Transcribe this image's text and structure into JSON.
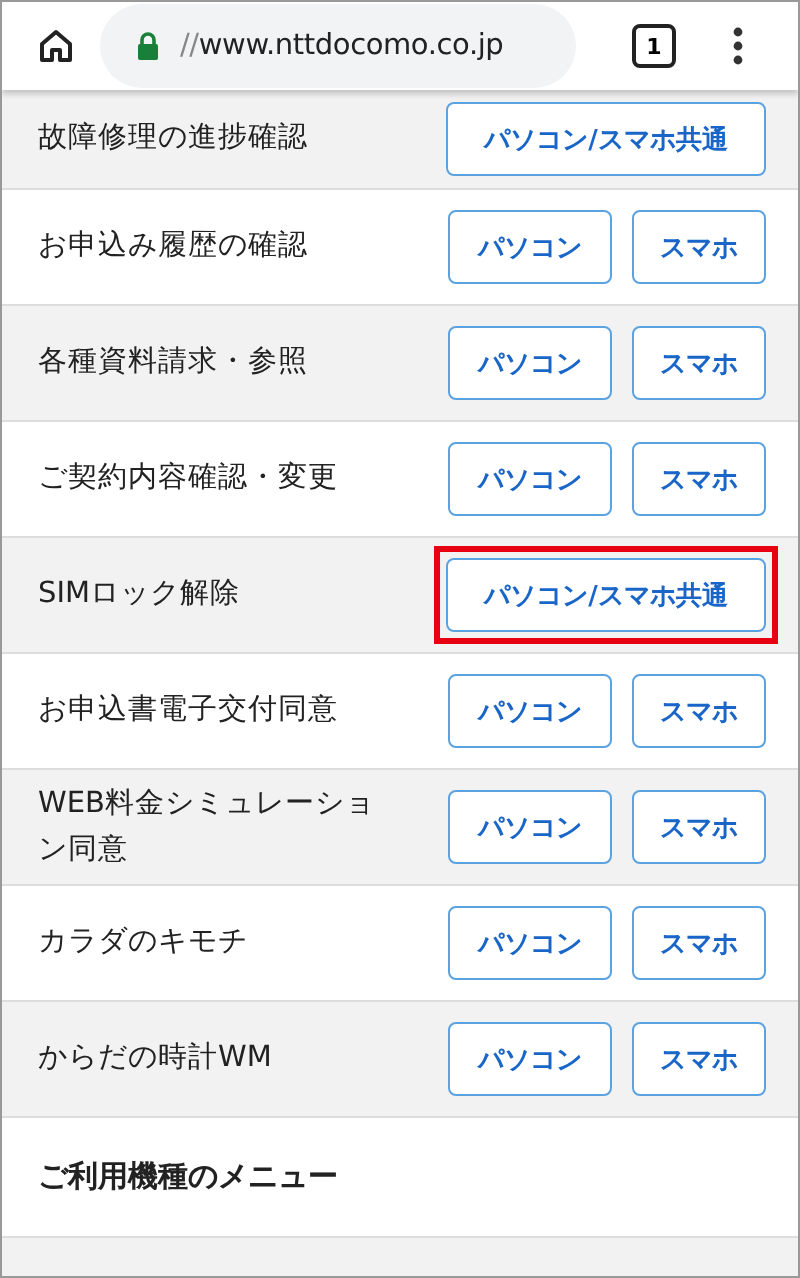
{
  "browser": {
    "url_prefix": "//",
    "url_host": "www.nttdocomo.co.jp",
    "tab_count": "1"
  },
  "rows": [
    {
      "label": "故障修理の進捗確認",
      "highlighted": false,
      "buttons": [
        {
          "label": "パソコン/スマホ共通",
          "kind": "wide"
        }
      ]
    },
    {
      "label": "お申込み履歴の確認",
      "highlighted": false,
      "buttons": [
        {
          "label": "パソコン",
          "kind": "normal"
        },
        {
          "label": "スマホ",
          "kind": "small"
        }
      ]
    },
    {
      "label": "各種資料請求・参照",
      "highlighted": false,
      "buttons": [
        {
          "label": "パソコン",
          "kind": "normal"
        },
        {
          "label": "スマホ",
          "kind": "small"
        }
      ]
    },
    {
      "label": "ご契約内容確認・変更",
      "highlighted": false,
      "buttons": [
        {
          "label": "パソコン",
          "kind": "normal"
        },
        {
          "label": "スマホ",
          "kind": "small"
        }
      ]
    },
    {
      "label": "SIMロック解除",
      "highlighted": true,
      "buttons": [
        {
          "label": "パソコン/スマホ共通",
          "kind": "wide"
        }
      ]
    },
    {
      "label": "お申込書電子交付同意",
      "highlighted": false,
      "buttons": [
        {
          "label": "パソコン",
          "kind": "normal"
        },
        {
          "label": "スマホ",
          "kind": "small"
        }
      ]
    },
    {
      "label": "WEB料金シミュレーション同意",
      "highlighted": false,
      "buttons": [
        {
          "label": "パソコン",
          "kind": "normal"
        },
        {
          "label": "スマホ",
          "kind": "small"
        }
      ]
    },
    {
      "label": "カラダのキモチ",
      "highlighted": false,
      "buttons": [
        {
          "label": "パソコン",
          "kind": "normal"
        },
        {
          "label": "スマホ",
          "kind": "small"
        }
      ]
    },
    {
      "label": "からだの時計WM",
      "highlighted": false,
      "buttons": [
        {
          "label": "パソコン",
          "kind": "normal"
        },
        {
          "label": "スマホ",
          "kind": "small"
        }
      ]
    }
  ],
  "section_heading": "ご利用機種のメニュー"
}
